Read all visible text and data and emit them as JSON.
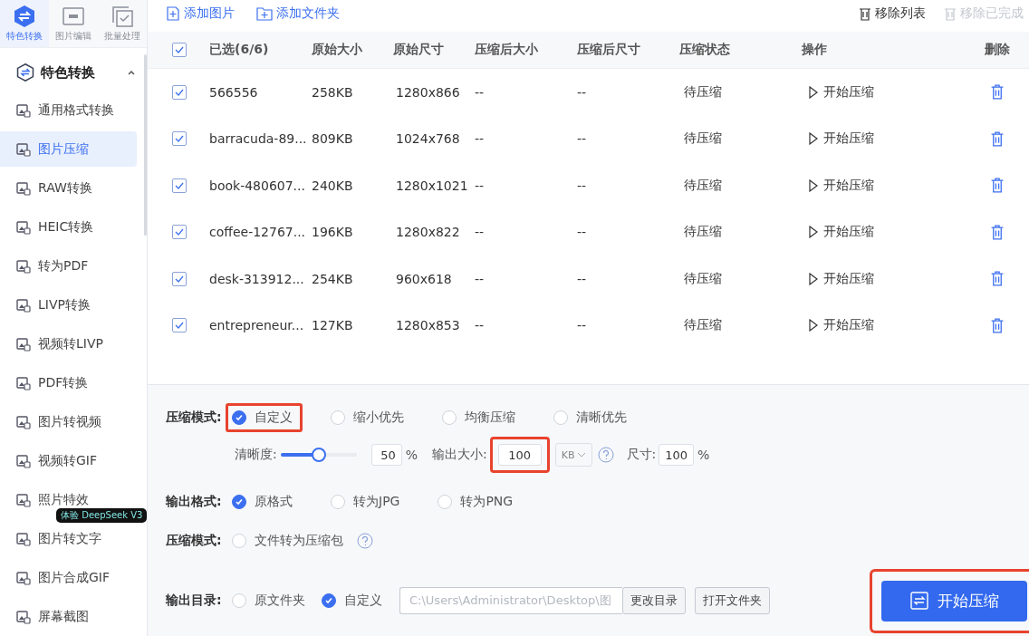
{
  "top_tabs": [
    {
      "label": "特色转换",
      "selected": true
    },
    {
      "label": "图片编辑",
      "selected": false
    },
    {
      "label": "批量处理",
      "selected": false
    }
  ],
  "sidebar": {
    "group": {
      "label": "特色转换",
      "expanded": true
    },
    "items": [
      {
        "label": "通用格式转换",
        "selected": false
      },
      {
        "label": "图片压缩",
        "selected": true
      },
      {
        "label": "RAW转换",
        "selected": false
      },
      {
        "label": "HEIC转换",
        "selected": false
      },
      {
        "label": "转为PDF",
        "selected": false
      },
      {
        "label": "LIVP转换",
        "selected": false
      },
      {
        "label": "视频转LIVP",
        "selected": false
      },
      {
        "label": "PDF转换",
        "selected": false
      },
      {
        "label": "图片转视频",
        "selected": false
      },
      {
        "label": "视频转GIF",
        "selected": false
      },
      {
        "label": "照片特效",
        "selected": false
      },
      {
        "label": "图片转文字",
        "selected": false,
        "badge": "体验 DeepSeek V3"
      },
      {
        "label": "图片合成GIF",
        "selected": false
      },
      {
        "label": "屏幕截图",
        "selected": false
      }
    ]
  },
  "toolbar": {
    "add_image": "添加图片",
    "add_folder": "添加文件夹",
    "remove_list": {
      "label": "移除列表",
      "disabled": false
    },
    "remove_done": {
      "label": "移除已完成",
      "disabled": true
    }
  },
  "table": {
    "select_all": true,
    "columns": [
      "已选(6/6)",
      "原始大小",
      "原始尺寸",
      "压缩后大小",
      "压缩后尺寸",
      "压缩状态",
      "操作",
      "删除"
    ],
    "rows": [
      {
        "checked": true,
        "name": "566556",
        "size": "258KB",
        "dims": "1280x866",
        "new_size": "--",
        "new_dims": "--",
        "status": "待压缩",
        "action": "开始压缩"
      },
      {
        "checked": true,
        "name": "barracuda-89...",
        "size": "809KB",
        "dims": "1024x768",
        "new_size": "--",
        "new_dims": "--",
        "status": "待压缩",
        "action": "开始压缩"
      },
      {
        "checked": true,
        "name": "book-480607...",
        "size": "240KB",
        "dims": "1280x1021",
        "new_size": "--",
        "new_dims": "--",
        "status": "待压缩",
        "action": "开始压缩"
      },
      {
        "checked": true,
        "name": "coffee-12767...",
        "size": "196KB",
        "dims": "1280x822",
        "new_size": "--",
        "new_dims": "--",
        "status": "待压缩",
        "action": "开始压缩"
      },
      {
        "checked": true,
        "name": "desk-313912...",
        "size": "254KB",
        "dims": "960x618",
        "new_size": "--",
        "new_dims": "--",
        "status": "待压缩",
        "action": "开始压缩"
      },
      {
        "checked": true,
        "name": "entrepreneur...",
        "size": "127KB",
        "dims": "1280x853",
        "new_size": "--",
        "new_dims": "--",
        "status": "待压缩",
        "action": "开始压缩"
      }
    ]
  },
  "settings": {
    "mode": {
      "label": "压缩模式:",
      "options": [
        {
          "label": "自定义",
          "selected": true,
          "highlighted": true
        },
        {
          "label": "缩小优先",
          "selected": false,
          "highlighted": false
        },
        {
          "label": "均衡压缩",
          "selected": false,
          "highlighted": false
        },
        {
          "label": "清晰优先",
          "selected": false,
          "highlighted": false
        }
      ]
    },
    "quality": {
      "label": "清晰度:",
      "level": 0.5,
      "value": "50",
      "unit": "%"
    },
    "output_size": {
      "label": "输出大小:",
      "value": "100",
      "highlighted": true,
      "unit": "KB"
    },
    "dimension": {
      "label": "尺寸:",
      "value": "100",
      "unit": "%"
    },
    "format": {
      "label": "输出格式:",
      "options": [
        {
          "label": "原格式",
          "selected": true
        },
        {
          "label": "转为JPG",
          "selected": false
        },
        {
          "label": "转为PNG",
          "selected": false
        }
      ]
    },
    "archive": {
      "label": "压缩模式:",
      "option": "文件转为压缩包",
      "checked": false
    },
    "output_dir": {
      "label": "输出目录:",
      "options": [
        {
          "label": "原文件夹",
          "selected": false
        },
        {
          "label": "自定义",
          "selected": true
        }
      ],
      "path": "C:\\Users\\Administrator\\Desktop\\图",
      "change": "更改目录",
      "open": "打开文件夹"
    },
    "start": {
      "label": "开始压缩",
      "highlighted": true
    }
  }
}
